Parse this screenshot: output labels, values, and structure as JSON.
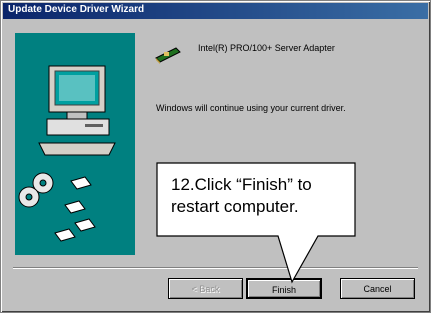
{
  "window": {
    "title": "Update Device Driver Wizard"
  },
  "content": {
    "device_name": "Intel(R) PRO/100+ Server Adapter",
    "message": "Windows will continue using your current driver."
  },
  "buttons": {
    "back_label": "< Back",
    "finish_label": "Finish",
    "cancel_label": "Cancel"
  },
  "callout": {
    "line1": "12.Click “Finish” to",
    "line2": "restart computer."
  },
  "colors": {
    "title_bar": "#0a246a",
    "side_panel": "#008080",
    "window_face": "#c0c0c0"
  },
  "icons": [
    "network-adapter-icon",
    "computer-icon",
    "cd-disks-icon",
    "floppy-disk-icon"
  ]
}
